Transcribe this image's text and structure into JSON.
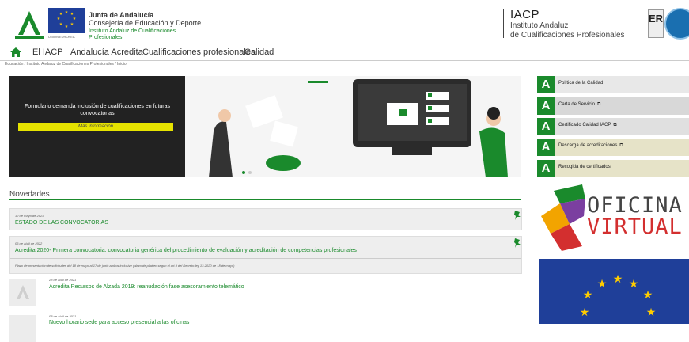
{
  "header": {
    "eu_caption": "UNIÓN EUROPEA",
    "org_name": "Junta de Andalucía",
    "org_ministry": "Consejería de Educación y Deporte",
    "org_institute": "Instituto Andaluz de Cualificaciones Profesionales",
    "iacp_title": "IACP",
    "iacp_sub1": "Instituto Andaluz",
    "iacp_sub2": "de Cualificaciones Profesionales",
    "er_badge": "ER"
  },
  "nav": {
    "items": [
      "El IACP",
      "Andalucía Acredita",
      "Cualificaciones profesionales",
      "Calidad"
    ]
  },
  "breadcrumb": "Educación / Instituto Andaluz de Cualificaciones Profesionales / Inicio",
  "banner": {
    "text": "Formulario demanda inclusión de cualificaciones en futuras convocatorias",
    "button": "Más información"
  },
  "news": {
    "title": "Novedades",
    "items": [
      {
        "date": "12 de mayo de 2023",
        "headline": "ESTADO DE LAS CONVOCATORIAS",
        "description": ""
      },
      {
        "date": "06 de abril de 2022",
        "headline": "Acredita 2020- Primera convocatoria: convocatoria genérica del procedimiento de evaluación y acreditación de competencias profesionales",
        "description": "Plazo de presentación de solicitudes del 18 de mayo al 17 de junio ambos inclusive (plazo de pladien segun el art.9 del Decreto-ley 13-2020 de 18 de mayo)"
      },
      {
        "date": "28 de abril de 2021",
        "headline": "Acredita Recursos de Alzada 2019: reanudación fase asesoramiento telemático",
        "description": ""
      },
      {
        "date": "08 de abril de 2021",
        "headline": "Nuevo horario sede para acceso presencial a las oficinas",
        "description": ""
      }
    ]
  },
  "sidebar": {
    "items": [
      {
        "label": "Política de la Calidad",
        "external": false
      },
      {
        "label": "Carta de Servicio",
        "external": true
      },
      {
        "label": "Certificado Calidad IACP",
        "external": true
      },
      {
        "label": "Descarga de acreditaciones",
        "external": true
      },
      {
        "label": "Recogida de certificados",
        "external": false
      }
    ],
    "oficina_line1": "OFICINA",
    "oficina_line2": "VIRTUAL"
  },
  "colors": {
    "accent_green": "#1a8a2c",
    "banner_button": "#e6e300",
    "eu_blue": "#1f3f99"
  }
}
